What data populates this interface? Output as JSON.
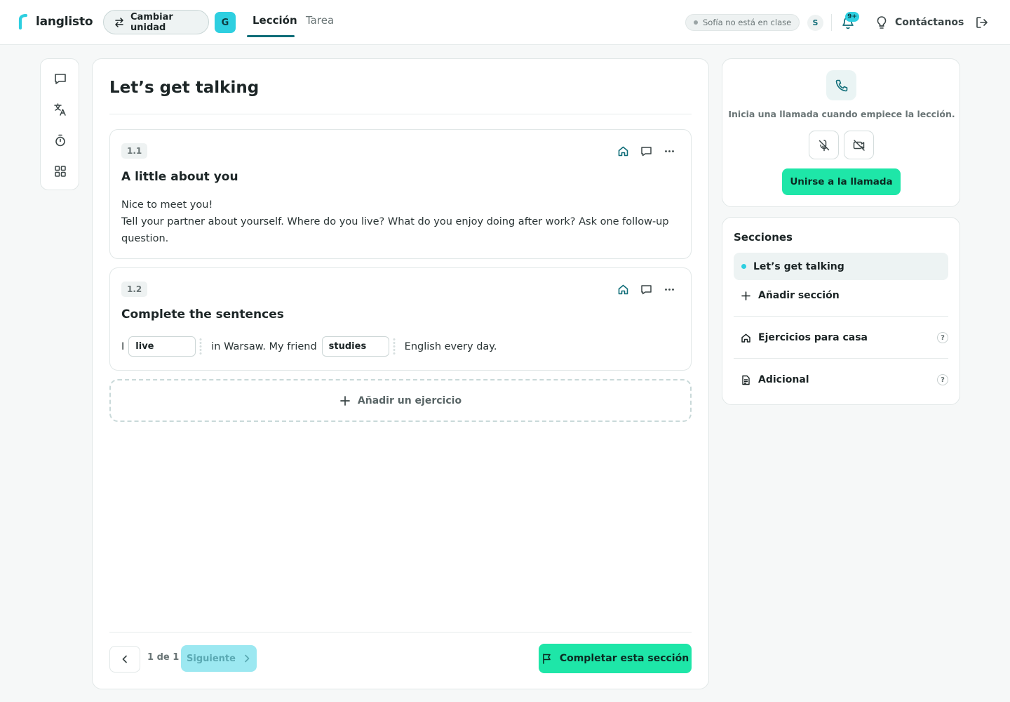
{
  "header": {
    "brand": "langlisto",
    "switch_unit_label": "Cambiar unidad",
    "group_badge": "G",
    "tabs": [
      {
        "label": "Lección",
        "active": true
      },
      {
        "label": "Tarea",
        "active": false
      }
    ],
    "student_status": "Sofía no está en clase",
    "student_initial": "S",
    "notifications_badge": "9+",
    "contact_label": "Contáctanos"
  },
  "lesson": {
    "title": "Let’s get talking",
    "exercises": [
      {
        "number": "1.1",
        "title": "A little about you",
        "lines": [
          "Nice to meet you!",
          "Tell your partner about yourself. Where do you live? What do you enjoy doing after work? Ask one follow-up question."
        ]
      },
      {
        "number": "1.2",
        "title": "Complete the sentences",
        "sentence": {
          "part1": "I",
          "gap1": "live",
          "part2": "in Warsaw. My friend",
          "gap2": "studies",
          "part3": "English every day."
        }
      }
    ],
    "add_exercise_label": "Añadir un ejercicio",
    "pagination": {
      "label": "1 de 1",
      "next_label": "Siguiente"
    },
    "complete_label": "Completar esta sección"
  },
  "call": {
    "hint": "Inicia una llamada cuando empiece la lección.",
    "join_label": "Unirse a la llamada"
  },
  "sections": {
    "title": "Secciones",
    "items": [
      {
        "label": "Let’s get talking",
        "active": true
      }
    ],
    "add_label": "Añadir sección",
    "homework_label": "Ejercicios para casa",
    "additional_label": "Adicional",
    "help_glyph": "?"
  },
  "colors": {
    "accent_teal": "#0f6d78",
    "accent_cyan": "#2ecfe0",
    "accent_green": "#1ee6a8"
  }
}
